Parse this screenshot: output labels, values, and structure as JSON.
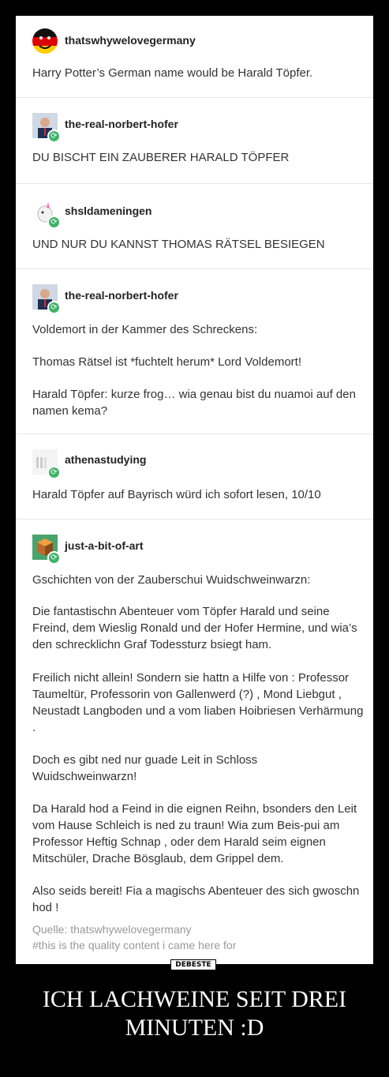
{
  "posts": [
    {
      "user": "thatswhywelovegermany",
      "paras": [
        "Harry Potter’s German name would be Harald Töpfer."
      ]
    },
    {
      "user": "the-real-norbert-hofer",
      "paras": [
        "DU BISCHT EIN ZAUBERER HARALD TÖPFER"
      ]
    },
    {
      "user": "shsldameningen",
      "paras": [
        "UND NUR DU KANNST THOMAS RÄTSEL BESIEGEN"
      ]
    },
    {
      "user": "the-real-norbert-hofer",
      "paras": [
        "Voldemort in der Kammer des Schreckens:",
        "Thomas Rätsel ist *fuchtelt herum* Lord Voldemort!",
        "Harald Töpfer: kurze frog… wia genau bist du nuamoi auf den namen kema?"
      ]
    },
    {
      "user": "athenastudying",
      "paras": [
        "Harald  Töpfer auf Bayrisch würd ich sofort lesen, 10/10"
      ]
    },
    {
      "user": "just-a-bit-of-art",
      "paras": [
        "Gschichten von der Zauberschui Wuidschweinwarzn:",
        "Die fantastischn Abenteuer vom Töpfer Harald und seine Freind, dem Wieslig Ronald und der Hofer Hermine, und wia’s den schrecklichn Graf Todessturz bsiegt ham.",
        "Freilich nicht allein! Sondern sie hattn a Hilfe von : Professor Taumeltür, Professorin von Gallenwerd (?) , Mond Liebgut , Neustadt Langboden und a vom liaben Hoibriesen Verhärmung .",
        "Doch es gibt ned nur guade Leit in Schloss Wuidschweinwarzn!",
        "Da Harald hod a Feind in die eignen Reihn, bsonders den Leit vom Hause Schleich is ned zu traun! Wia zum Beis-pui am Professor Heftig Schnap , oder dem Harald seim eignen Mitschüler, Drache Bösglaub, dem Grippel dem.",
        "Also seids bereit! Fia a magischs Abenteuer des sich gwoschn hod !"
      ]
    }
  ],
  "footer": {
    "source": "Quelle: thatswhywelovegermany",
    "tags": "#this is the quality content i came here for"
  },
  "watermark": "DEBESTE",
  "caption": {
    "line1": "ICH LACHWEINE SEIT DREI",
    "line2": "MINUTEN :D"
  },
  "icons": {
    "reblog": "reblog-icon"
  }
}
